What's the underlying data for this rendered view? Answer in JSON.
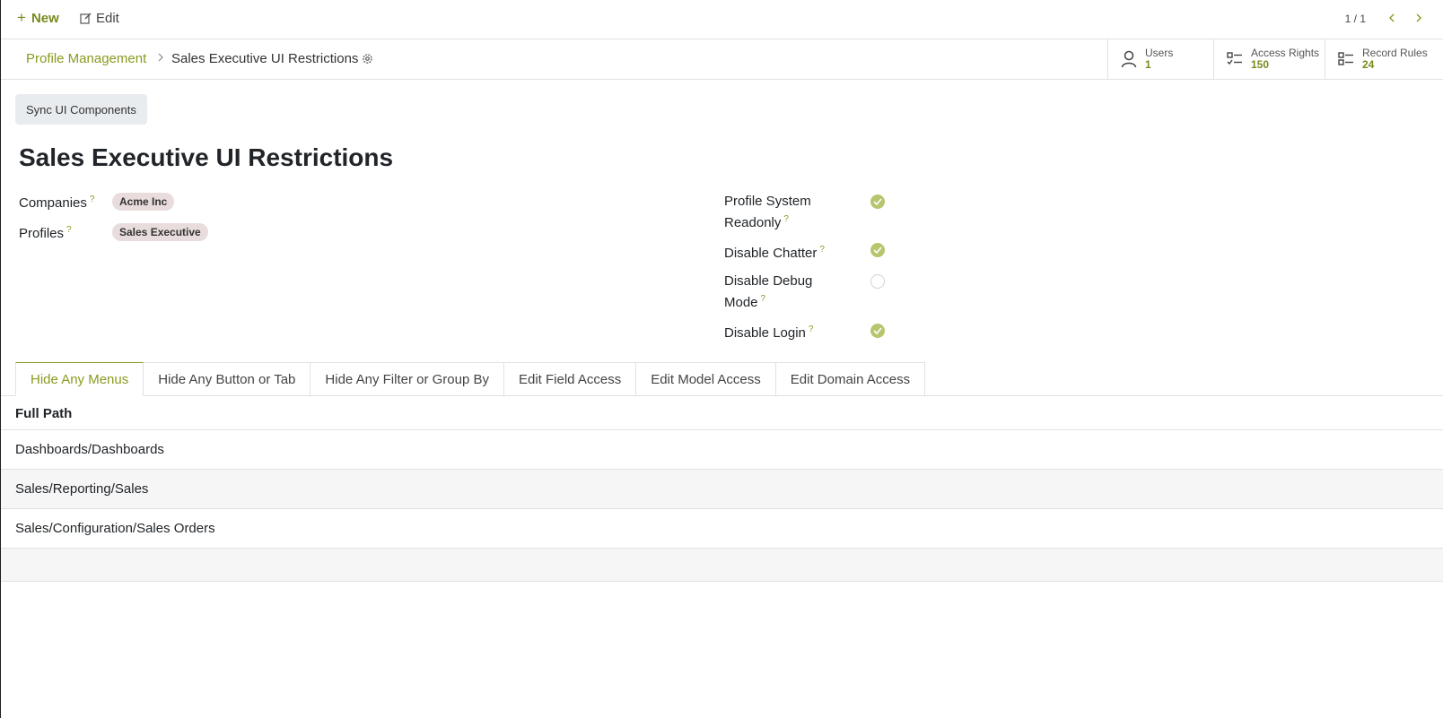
{
  "toolbar": {
    "new_label": "New",
    "edit_label": "Edit",
    "pager": "1 / 1"
  },
  "breadcrumb": {
    "root": "Profile Management",
    "current": "Sales Executive UI Restrictions"
  },
  "smart_buttons": [
    {
      "label": "Users",
      "value": "1",
      "icon": "user-icon"
    },
    {
      "label": "Access Rights",
      "value": "150",
      "icon": "list-check-icon"
    },
    {
      "label": "Record Rules",
      "value": "24",
      "icon": "list-icon"
    }
  ],
  "sync_button": "Sync UI Components",
  "title": "Sales Executive UI Restrictions",
  "fields": {
    "companies": {
      "label": "Companies",
      "tag": "Acme Inc"
    },
    "profiles": {
      "label": "Profiles",
      "tag": "Sales Executive"
    }
  },
  "toggles": [
    {
      "line1": "Profile System",
      "line2": "Readonly",
      "checked": true
    },
    {
      "line1": "Disable Chatter",
      "line2": "",
      "checked": true
    },
    {
      "line1": "Disable Debug",
      "line2": "Mode",
      "checked": false
    },
    {
      "line1": "Disable Login",
      "line2": "",
      "checked": true
    }
  ],
  "help_mark": "?",
  "tabs": [
    "Hide Any Menus",
    "Hide Any Button or Tab",
    "Hide Any Filter or Group By",
    "Edit Field Access",
    "Edit Model Access",
    "Edit Domain Access"
  ],
  "table": {
    "header": "Full Path",
    "rows": [
      "Dashboards/Dashboards",
      "Sales/Reporting/Sales",
      "Sales/Configuration/Sales Orders"
    ]
  },
  "colors": {
    "accent": "#8a9a1f",
    "check_on": "#b9c46f",
    "tag_bg": "#e8dcdc"
  }
}
